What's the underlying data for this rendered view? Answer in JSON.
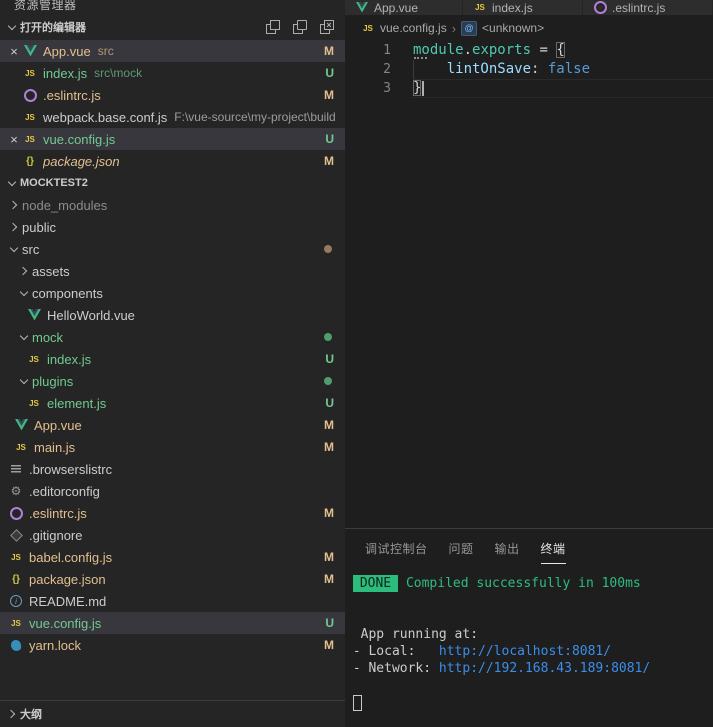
{
  "explorer": {
    "title": "资源管理器",
    "open_editors": {
      "header": "打开的编辑器",
      "items": [
        {
          "label": "App.vue",
          "description": "src",
          "badge": "M",
          "status": "modified"
        },
        {
          "label": "index.js",
          "description": "src\\mock",
          "badge": "U",
          "status": "untracked"
        },
        {
          "label": ".eslintrc.js",
          "description": "",
          "badge": "M",
          "status": "modified"
        },
        {
          "label": "webpack.base.conf.js",
          "description": "F:\\vue-source\\my-project\\build",
          "badge": "",
          "status": "normal"
        },
        {
          "label": "vue.config.js",
          "description": "",
          "badge": "U",
          "status": "untracked"
        },
        {
          "label": "package.json",
          "description": "",
          "badge": "M",
          "status": "modified"
        }
      ]
    },
    "tree": {
      "header": "MOCKTEST2",
      "items": [
        {
          "label": "node_modules",
          "type": "folder",
          "status": "ignored"
        },
        {
          "label": "public",
          "type": "folder",
          "status": "normal"
        },
        {
          "label": "src",
          "type": "folder",
          "status": "normal",
          "dot": "modified"
        },
        {
          "label": "assets",
          "type": "folder",
          "status": "normal"
        },
        {
          "label": "components",
          "type": "folder",
          "status": "normal"
        },
        {
          "label": "HelloWorld.vue",
          "type": "file",
          "status": "normal"
        },
        {
          "label": "mock",
          "type": "folder",
          "status": "untracked",
          "dot": "untracked"
        },
        {
          "label": "index.js",
          "type": "file",
          "status": "untracked",
          "badge": "U"
        },
        {
          "label": "plugins",
          "type": "folder",
          "status": "untracked",
          "dot": "untracked"
        },
        {
          "label": "element.js",
          "type": "file",
          "status": "untracked",
          "badge": "U"
        },
        {
          "label": "App.vue",
          "type": "file",
          "status": "modified",
          "badge": "M"
        },
        {
          "label": "main.js",
          "type": "file",
          "status": "modified",
          "badge": "M"
        },
        {
          "label": ".browserslistrc",
          "type": "file",
          "status": "normal"
        },
        {
          "label": ".editorconfig",
          "type": "file",
          "status": "normal"
        },
        {
          "label": ".eslintrc.js",
          "type": "file",
          "status": "modified",
          "badge": "M"
        },
        {
          "label": ".gitignore",
          "type": "file",
          "status": "normal"
        },
        {
          "label": "babel.config.js",
          "type": "file",
          "status": "modified",
          "badge": "M"
        },
        {
          "label": "package.json",
          "type": "file",
          "status": "modified",
          "badge": "M"
        },
        {
          "label": "README.md",
          "type": "file",
          "status": "normal"
        },
        {
          "label": "vue.config.js",
          "type": "file",
          "status": "untracked",
          "badge": "U"
        },
        {
          "label": "yarn.lock",
          "type": "file",
          "status": "modified",
          "badge": "M"
        }
      ]
    },
    "outline": {
      "header": "大纲"
    }
  },
  "editor_tabs": [
    {
      "label": "App.vue"
    },
    {
      "label": "index.js"
    },
    {
      "label": ".eslintrc.js"
    }
  ],
  "breadcrumb": {
    "file": "vue.config.js",
    "separator": "›",
    "symbol": "<unknown>"
  },
  "editor": {
    "lines": [
      {
        "number": "1",
        "t1": "module",
        "t2": ".",
        "t3": "exports",
        "t4": " = ",
        "t5": "{"
      },
      {
        "number": "2",
        "indent": "    ",
        "t1": "lintOnSave",
        "t2": ": ",
        "t3": "false"
      },
      {
        "number": "3",
        "t1": "}"
      }
    ]
  },
  "panel": {
    "tabs": [
      {
        "label": "调试控制台"
      },
      {
        "label": "问题"
      },
      {
        "label": "输出"
      },
      {
        "label": "终端"
      }
    ],
    "active_tab": "终端",
    "terminal": {
      "badge": "DONE",
      "message": "Compiled successfully in 100ms",
      "info_line": "App running at:",
      "local_label": "- Local:",
      "local_url": "http://localhost:8081/",
      "network_label": "- Network:",
      "network_url": "http://192.168.43.189:8081/"
    }
  },
  "colors": {
    "modified": "#e2c08d",
    "untracked": "#73c991",
    "ignored": "#8c8c8c",
    "selection_bg": "#37373d",
    "vue_green": "#41b883",
    "js_yellow": "#e3c945",
    "eslint_purple": "#b07fd6",
    "yarn_blue": "#368fb9",
    "link_blue": "#3b8eea",
    "terminal_green": "#2dbd81",
    "done_badge_bg": "#2cbc7c",
    "token_teal": "#4ec9b0",
    "token_light_blue": "#9cdcfe",
    "token_keyword_blue": "#569cd6"
  }
}
